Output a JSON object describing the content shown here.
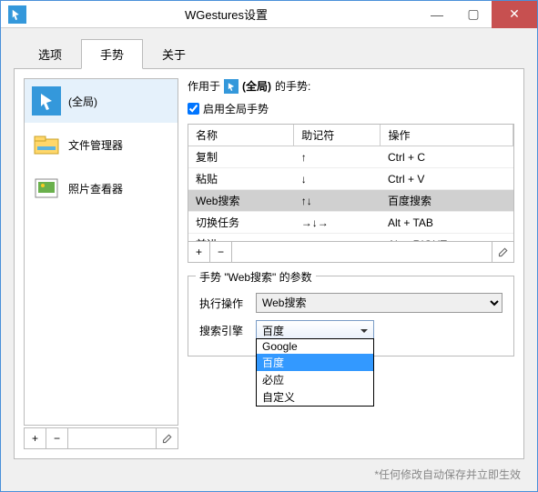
{
  "window": {
    "title": "WGestures设置"
  },
  "tabs": {
    "options": "选项",
    "gestures": "手势",
    "about": "关于"
  },
  "sidebar": {
    "items": [
      {
        "label": "(全局)"
      },
      {
        "label": "文件管理器"
      },
      {
        "label": "照片查看器"
      }
    ]
  },
  "main": {
    "appliesPrefix": "作用于",
    "appliesTarget": "(全局)",
    "appliesSuffix": "的手势:",
    "enableGlobal": "启用全局手势",
    "columns": {
      "name": "名称",
      "mnemonic": "助记符",
      "action": "操作"
    },
    "rows": [
      {
        "name": "复制",
        "mnemonic": "↑",
        "action": "Ctrl + C"
      },
      {
        "name": "粘贴",
        "mnemonic": "↓",
        "action": "Ctrl + V"
      },
      {
        "name": "Web搜索",
        "mnemonic": "↑↓",
        "action": "百度搜索"
      },
      {
        "name": "切换任务",
        "mnemonic": "→↓→",
        "action": "Alt + TAB"
      },
      {
        "name": "前进",
        "mnemonic": "→",
        "action": "Alt + RIGHT"
      }
    ]
  },
  "params": {
    "legend": "手势 \"Web搜索\" 的参数",
    "actionLabel": "执行操作",
    "actionValue": "Web搜索",
    "engineLabel": "搜索引擎",
    "engineSelected": "百度",
    "engineOptions": [
      "Google",
      "百度",
      "必应",
      "自定义"
    ]
  },
  "footer": "*任何修改自动保存并立即生效"
}
